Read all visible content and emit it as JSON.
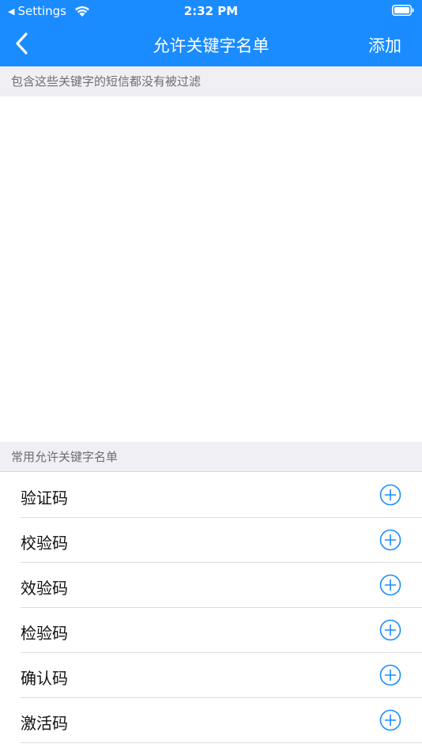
{
  "status_bar": {
    "back_app": "Settings",
    "time": "2:32 PM"
  },
  "nav": {
    "title": "允许关键字名单",
    "add_label": "添加"
  },
  "allow_section": {
    "caption": "包含这些关键字的短信都没有被过滤"
  },
  "common_section": {
    "caption": "常用允许关键字名单",
    "items": [
      {
        "label": "验证码"
      },
      {
        "label": "校验码"
      },
      {
        "label": "效验码"
      },
      {
        "label": "检验码"
      },
      {
        "label": "确认码"
      },
      {
        "label": "激活码"
      }
    ]
  },
  "colors": {
    "accent": "#1a8cff",
    "section_bg": "#efeff4"
  }
}
